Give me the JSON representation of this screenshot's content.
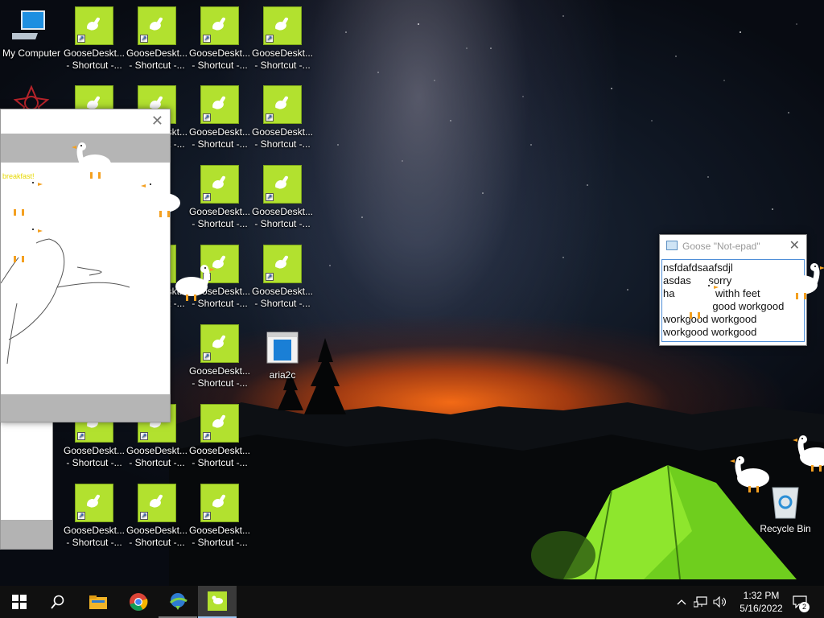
{
  "desktop": {
    "my_computer_label": "My Computer",
    "goose_shortcut_label": "GooseDeskt...\n- Shortcut -...",
    "goose_shortcut_label_clipped": "...\n...",
    "aria2c_label": "aria2c",
    "recycle_bin_label": "Recycle Bin",
    "tile_color": "#b2e12f"
  },
  "notepad": {
    "title": "Goose \"Not-epad\"",
    "lines": [
      "nsfdafdsaafsdjl",
      "asdas      sorry",
      "ha              withh feet",
      "                 good workgood",
      "workgood workgood",
      "workgood workgood"
    ]
  },
  "paint_window": {
    "yellow_text": "breakfast!"
  },
  "taskbar": {
    "start_icon": "windows-logo-icon",
    "search_icon": "search-icon",
    "pinned": [
      "file-explorer-icon",
      "chrome-icon",
      "idm-icon",
      "goose-app-icon"
    ],
    "time": "1:32 PM",
    "date": "5/16/2022",
    "notification_count": "2"
  }
}
